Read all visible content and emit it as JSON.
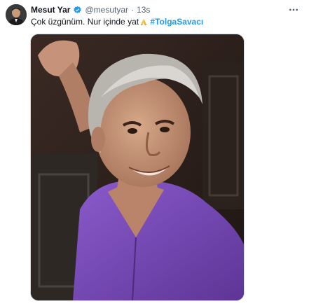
{
  "tweet": {
    "author_name": "Mesut Yar",
    "handle": "@mesutyar",
    "separator": "·",
    "time": "13s",
    "text": "Çok üzgünüm. Nur içinde yat",
    "emoji": "praying-hands-icon",
    "hashtag": "#TolgaSavacı",
    "more_icon": "more-icon",
    "verified_icon": "verified-badge-icon"
  },
  "colors": {
    "link": "#1d9bf0",
    "verified": "#1d9bf0",
    "muted": "#536471",
    "shirt": "#7a4ab8"
  }
}
